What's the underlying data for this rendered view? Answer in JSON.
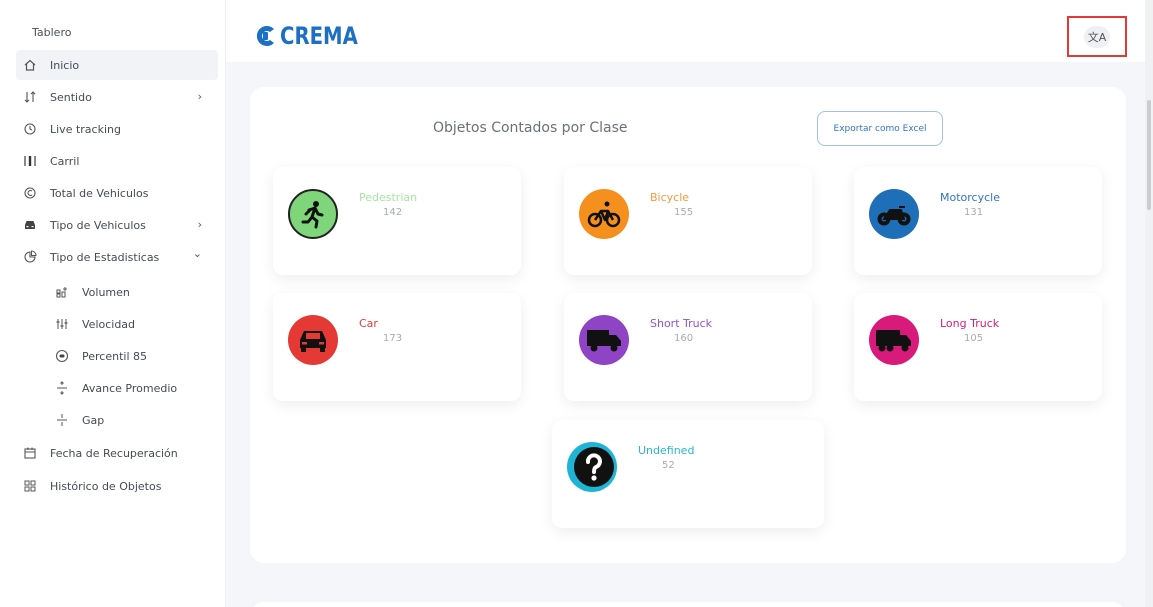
{
  "sidebar": {
    "title": "Tablero",
    "items": [
      {
        "label": "Inicio",
        "icon": "home-icon"
      },
      {
        "label": "Sentido",
        "icon": "sort-arrows-icon",
        "chevron": "›"
      },
      {
        "label": "Live tracking",
        "icon": "clock-icon"
      },
      {
        "label": "Carril",
        "icon": "lanes-icon"
      },
      {
        "label": "Total de Vehiculos",
        "icon": "counter-icon"
      },
      {
        "label": "Tipo de Vehiculos",
        "icon": "car-icon",
        "chevron": "›"
      },
      {
        "label": "Tipo de Estadisticas",
        "icon": "stats-icon",
        "chevron": "⌄"
      },
      {
        "label": "Volumen",
        "icon": "volume-icon"
      },
      {
        "label": "Velocidad",
        "icon": "speed-icon"
      },
      {
        "label": "Percentil 85",
        "icon": "percentile-icon"
      },
      {
        "label": "Avance Promedio",
        "icon": "divide-icon"
      },
      {
        "label": "Gap",
        "icon": "gap-icon"
      },
      {
        "label": "Fecha de Recuperación",
        "icon": "calendar-icon"
      },
      {
        "label": "Histórico de Objetos",
        "icon": "grid-icon"
      }
    ]
  },
  "header": {
    "logo_text": "CREMA",
    "lang_icon": "translate-icon",
    "lang_glyph": "文A"
  },
  "main": {
    "title": "Objetos Contados por Clase",
    "export_label": "Exportar como Excel",
    "classes": [
      {
        "name": "Pedestrian",
        "count": "142",
        "color": "#a8e6a1",
        "icon_bg": "#7fd67a"
      },
      {
        "name": "Bicycle",
        "count": "155",
        "color": "#f39c3c",
        "icon_bg": "#f5901f"
      },
      {
        "name": "Motorcycle",
        "count": "131",
        "color": "#2f75c7",
        "icon_bg": "#1f6fb8"
      },
      {
        "name": "Car",
        "count": "173",
        "color": "#e53935",
        "icon_bg": "#e53935"
      },
      {
        "name": "Short Truck",
        "count": "160",
        "color": "#9b4fc9",
        "icon_bg": "#8e44c4"
      },
      {
        "name": "Long Truck",
        "count": "105",
        "color": "#d81b7a",
        "icon_bg": "#d81b7a"
      },
      {
        "name": "Undefined",
        "count": "52",
        "color": "#29b6d8",
        "icon_bg": "#1fb3d6"
      }
    ]
  }
}
